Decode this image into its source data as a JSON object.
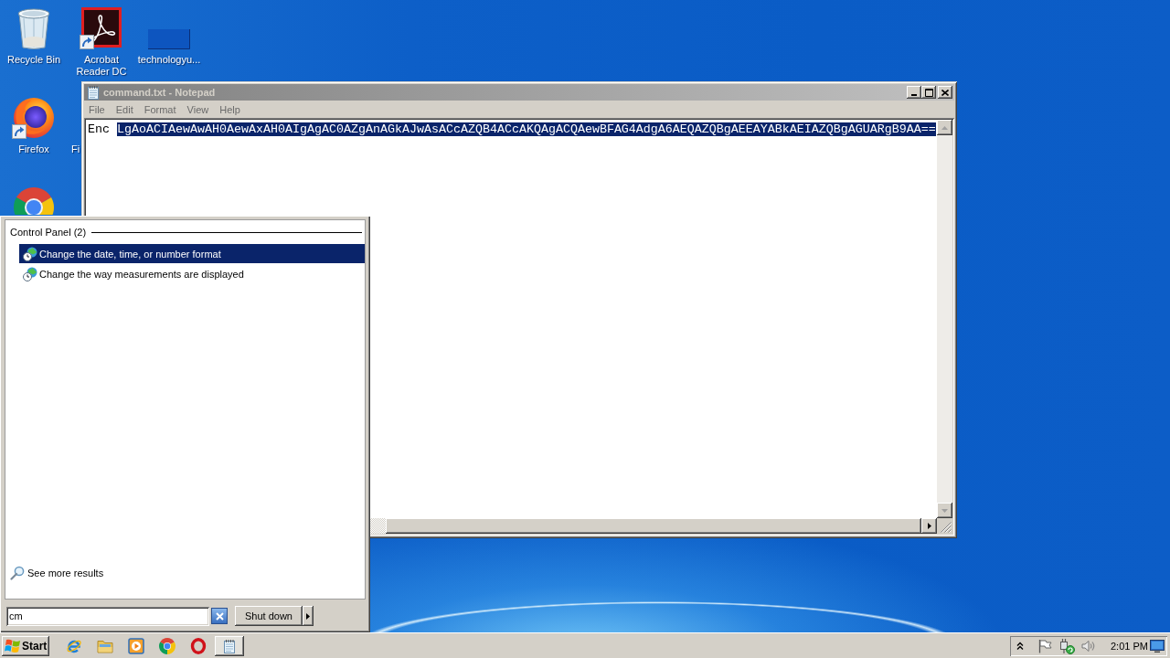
{
  "desktop": {
    "columns": [
      {
        "icons": [
          {
            "kind": "recycle-bin",
            "label": "Recycle Bin",
            "shortcut": false
          },
          {
            "kind": "firefox",
            "label": "Firefox",
            "shortcut": true
          },
          {
            "kind": "chrome",
            "shortcut": false
          }
        ]
      },
      {
        "icons": [
          {
            "kind": "acrobat",
            "label": "Acrobat Reader DC",
            "shortcut": true
          },
          {
            "kind": "covered",
            "label": "Fi",
            "shortcut": false
          }
        ]
      },
      {
        "icons": [
          {
            "kind": "file",
            "label": "technologyu...",
            "shortcut": false
          }
        ]
      }
    ]
  },
  "notepad": {
    "title": "command.txt - Notepad",
    "active": false,
    "menu": [
      "File",
      "Edit",
      "Format",
      "View",
      "Help"
    ],
    "lines": [
      {
        "segments": [
          {
            "text": "Enc",
            "selected": false
          },
          {
            "text": "LgAoACIAewAwAH0AewAxAH0AIgAgAC0AZgAnAGkAJwAsACcAZQB4ACcAKQAgACQAewBFAG4AdgA6AEQAZQBgAEEAYABkAEIAZQBgAGUARgB9AA==",
            "selected": true
          }
        ]
      }
    ]
  },
  "start_menu": {
    "group": {
      "title": "Control Panel (2)",
      "results": [
        {
          "label": "Change the date, time, or number format",
          "selected": true
        },
        {
          "label": "Change the way measurements are displayed",
          "selected": false
        }
      ]
    },
    "more_results": "See more results",
    "search": {
      "value": "cm"
    },
    "shut_down": "Shut down"
  },
  "taskbar": {
    "start": "Start",
    "quick_launch": [
      {
        "kind": "ie"
      },
      {
        "kind": "explorer"
      },
      {
        "kind": "media"
      },
      {
        "kind": "chrome"
      },
      {
        "kind": "opera"
      }
    ],
    "tasks": [
      {
        "kind": "notepad"
      }
    ],
    "tray": {
      "icons": [
        {
          "kind": "chevron"
        },
        {
          "kind": "flag"
        },
        {
          "kind": "network"
        },
        {
          "kind": "volume"
        }
      ],
      "clock": "2:01 PM"
    }
  }
}
